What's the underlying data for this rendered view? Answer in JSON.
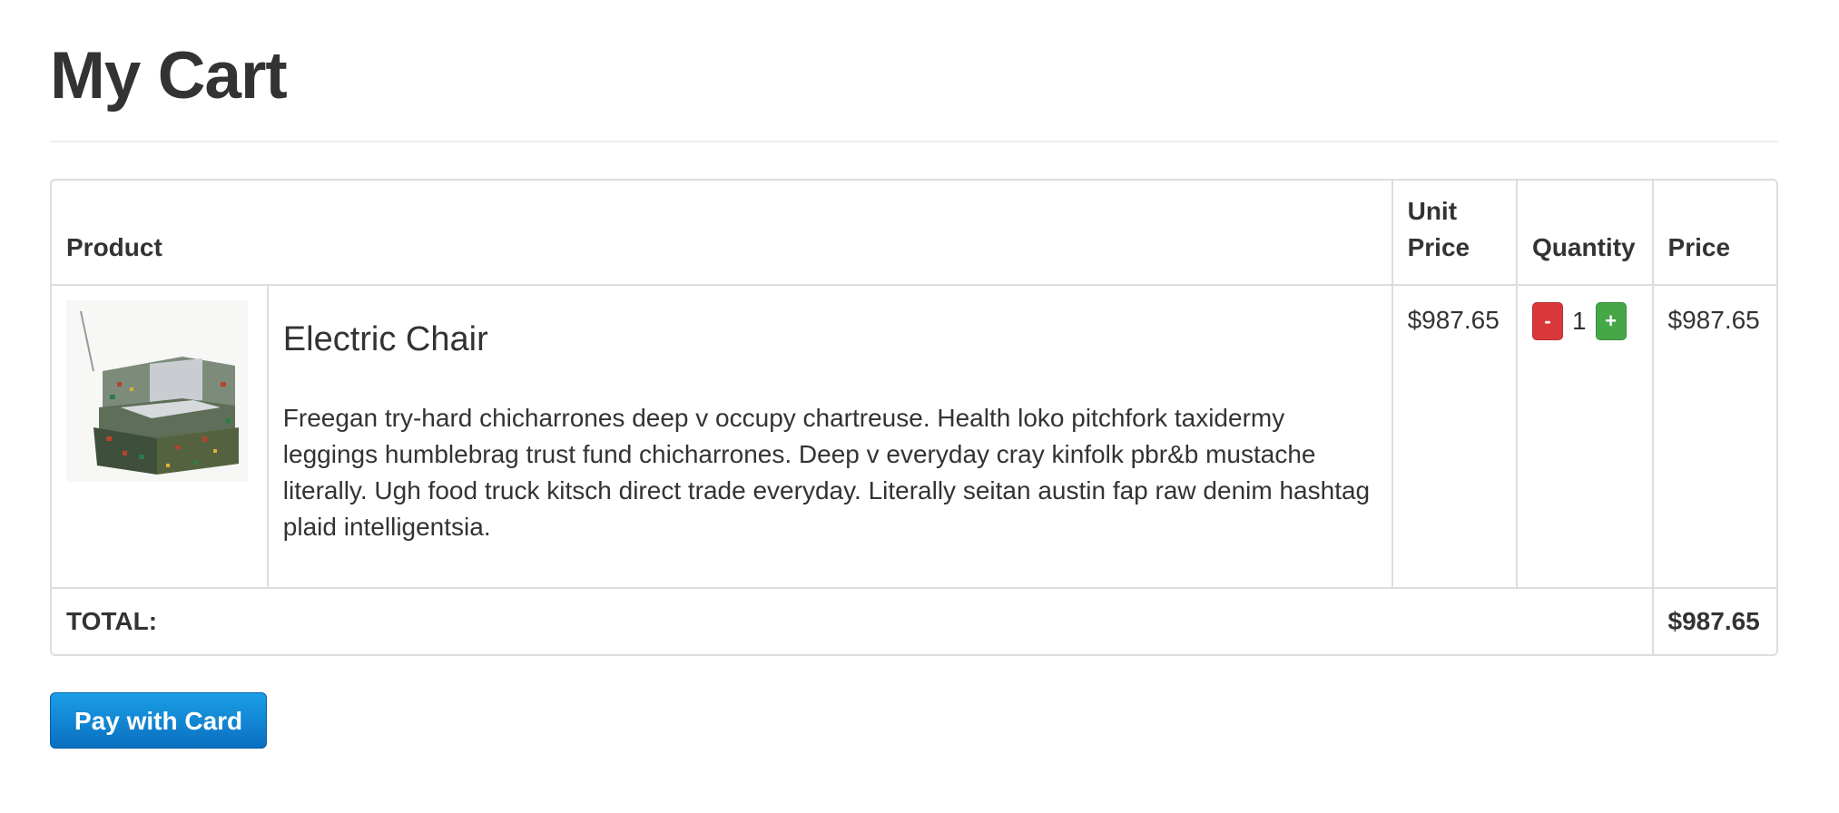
{
  "page": {
    "title": "My Cart"
  },
  "table": {
    "headers": {
      "product": "Product",
      "unit_price": "Unit Price",
      "quantity": "Quantity",
      "price": "Price"
    },
    "rows": [
      {
        "image_icon": "chair-image",
        "name": "Electric Chair",
        "description": "Freegan try-hard chicharrones deep v occupy chartreuse. Health loko pitchfork taxidermy leggings humblebrag trust fund chicharrones. Deep v everyday cray kinfolk pbr&b mustache literally. Ugh food truck kitsch direct trade everyday. Literally seitan austin fap raw denim hashtag plaid intelligentsia.",
        "unit_price": "$987.65",
        "quantity": "1",
        "minus_label": "-",
        "plus_label": "+",
        "price": "$987.65"
      }
    ],
    "total_label": "TOTAL:",
    "total_value": "$987.65"
  },
  "actions": {
    "pay_label": "Pay with Card"
  },
  "colors": {
    "minus_button": "#d9383a",
    "plus_button": "#45a748",
    "pay_button": "#0a8ad6"
  }
}
